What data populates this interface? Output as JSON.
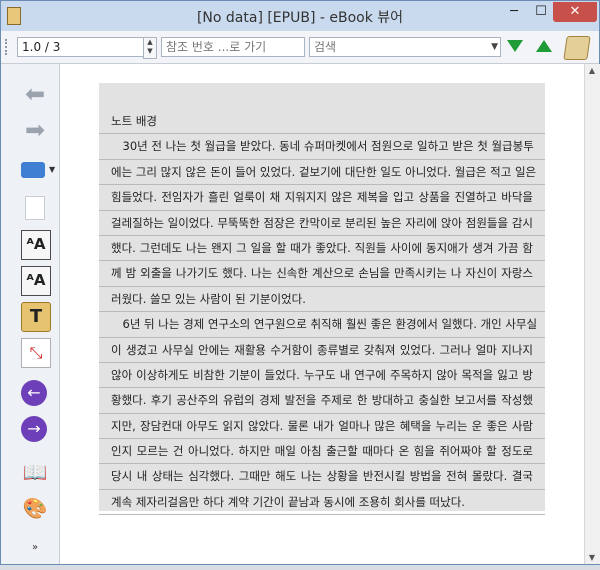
{
  "window": {
    "title": "[No data] [EPUB] - eBook 뷰어",
    "controls": {
      "minimize": "─",
      "maximize": "☐",
      "close": "✕"
    }
  },
  "toolbar": {
    "page_value": "1.0 / 3",
    "ref_placeholder": "참조 번호 ...로 가기",
    "search_placeholder": "검색"
  },
  "sidebar": {
    "icons": [
      "back-arrow-icon",
      "forward-arrow-icon",
      "print-icon",
      "document-icon",
      "font-larger-icon",
      "font-smaller-icon",
      "text-icon",
      "fit-screen-icon",
      "previous-icon",
      "next-icon",
      "library-icon",
      "theme-icon",
      "more-chevron-icon"
    ]
  },
  "content": {
    "lines": [
      "노트 배경",
      "　30년 전 나는 첫 월급을 받았다. 동네 슈퍼마켓에서 점원으로 일하고 받은 첫 월급봉투",
      "에는 그리 많지 않은 돈이 들어 있었다. 겉보기에 대단한 일도 아니었다. 월급은 적고 일은",
      "힘들었다. 전임자가 흘린 얼룩이 채 지워지지 않은 제복을 입고 상품을 진열하고 바닥을",
      "걸레질하는 일이었다. 무뚝뚝한 점장은 칸막이로 분리된 높은 자리에 앉아 점원들을 감시",
      "했다. 그런데도 나는 왠지 그 일을 할 때가 좋았다. 직원들 사이에 동지애가 생겨 가끔 함",
      "께 밤 외출을 나가기도 했다. 나는 신속한 계산으로 손님을 만족시키는 나 자신이 자랑스",
      "러웠다. 쓸모 있는 사람이 된 기분이었다.",
      "　6년 뒤 나는 경제 연구소의 연구원으로 취직해 훨씬 좋은 환경에서 일했다. 개인 사무실",
      "이 생겼고 사무실 안에는 재활용 수거함이 종류별로 갖춰져 있었다. 그러나 얼마 지나지",
      "않아 이상하게도 비참한 기분이 들었다. 누구도 내 연구에 주목하지 않아 목적을 잃고 방",
      "황했다. 후기 공산주의 유럽의 경제 발전을 주제로 한 방대하고 충실한 보고서를 작성했",
      "지만, 장담컨대 아무도 읽지 않았다. 물론 내가 얼마나 많은 혜택을 누리는 운 좋은 사람",
      "인지 모르는 건 아니었다. 하지만 매일 아침 출근할 때마다 온 힘을 쥐어짜야 할 정도로",
      "당시 내 상태는 심각했다. 그때만 해도 나는 상황을 반전시킬 방법을 전혀 몰랐다. 결국",
      "계속 제자리걸음만 하다 계약 기간이 끝남과 동시에 조용히 회사를 떠났다."
    ]
  },
  "colors": {
    "titlebar": "#c9d9ee",
    "close_button": "#c7504a",
    "nav_arrow": "#1f9b37",
    "page_background": "#e2e2e2"
  }
}
